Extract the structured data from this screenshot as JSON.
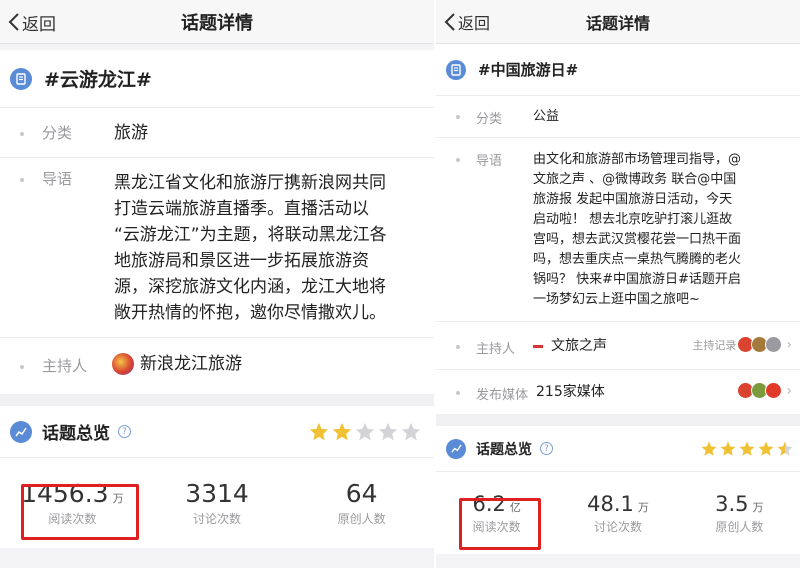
{
  "left": {
    "nav": {
      "back": "返回",
      "title": "话题详情"
    },
    "topic": {
      "title": "#云游龙江#"
    },
    "category": {
      "label": "分类",
      "value": "旅游"
    },
    "guide": {
      "label": "导语",
      "lines": [
        "黑龙江省文化和旅游厅携新浪网共同",
        "打造云端旅游直播季。直播活动以",
        "“云游龙江”为主题，将联动黑龙江各",
        "地旅游局和景区进一步拓展旅游资",
        "源，深挖旅游文化内涵，龙江大地将",
        "敞开热情的怀抱，邀你尽情撒欢儿。"
      ]
    },
    "host": {
      "label": "主持人",
      "value": "新浪龙江旅游"
    },
    "overview": {
      "title": "话题总览",
      "help": "?",
      "rating": 2,
      "max": 5
    },
    "stats": [
      {
        "value": "1456.3",
        "unit": "万",
        "label": "阅读次数"
      },
      {
        "value": "3314",
        "unit": "",
        "label": "讨论次数"
      },
      {
        "value": "64",
        "unit": "",
        "label": "原创人数"
      }
    ]
  },
  "right": {
    "nav": {
      "back": "返回",
      "title": "话题详情"
    },
    "topic": {
      "title": "#中国旅游日#"
    },
    "category": {
      "label": "分类",
      "value": "公益"
    },
    "guide": {
      "label": "导语",
      "lines": [
        "由文化和旅游部市场管理司指导，@",
        "文旅之声 、@微博政务 联合@中国",
        "旅游报 发起中国旅游日活动，今天",
        "启动啦！ 想去北京吃驴打滚儿逛故",
        "宫吗，想去武汉赏樱花尝一口热干面",
        "吗，想去重庆点一桌热气腾腾的老火",
        "锅吗？ 快来#中国旅游日#话题开启",
        "一场梦幻云上逛中国之旅吧~"
      ]
    },
    "host": {
      "label": "主持人",
      "value": "文旅之声",
      "record": "主持记录"
    },
    "media": {
      "label": "发布媒体",
      "value": "215家媒体"
    },
    "overview": {
      "title": "话题总览",
      "help": "?",
      "rating": 4.5,
      "max": 5
    },
    "stats": [
      {
        "value": "6.2",
        "unit": "亿",
        "label": "阅读次数"
      },
      {
        "value": "48.1",
        "unit": "万",
        "label": "讨论次数"
      },
      {
        "value": "3.5",
        "unit": "万",
        "label": "原创人数"
      }
    ]
  },
  "colors": {
    "accent": "#5a8bd6",
    "star_on": "#f0c233",
    "star_off": "#d4d4d8",
    "highlight": "#e02020"
  },
  "icons": {
    "back": "chevron-left-icon",
    "topic": "document-icon",
    "overview": "chart-icon",
    "help": "help-icon",
    "star": "star-icon"
  }
}
